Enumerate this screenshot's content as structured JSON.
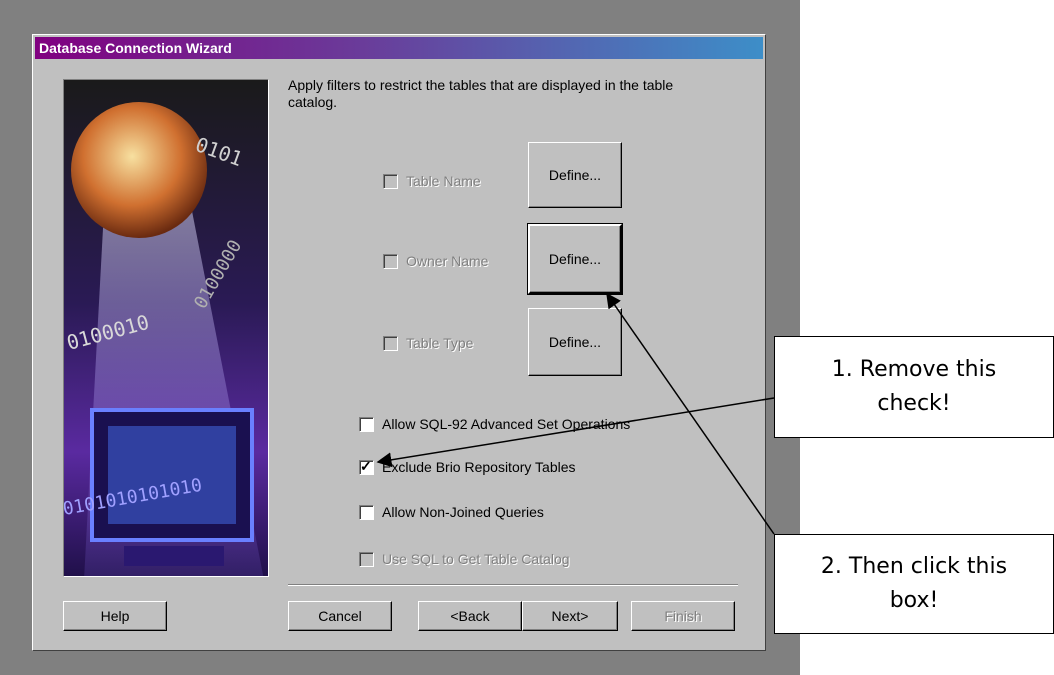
{
  "dialog": {
    "title": "Database Connection Wizard",
    "intro": "Apply filters to restrict the tables that are displayed in the table catalog."
  },
  "filters": [
    {
      "label": "Table Name",
      "button": "Define..."
    },
    {
      "label": "Owner Name",
      "button": "Define..."
    },
    {
      "label": "Table Type",
      "button": "Define..."
    }
  ],
  "options": [
    {
      "label": "Allow SQL-92 Advanced Set Operations",
      "checked": false,
      "enabled": true
    },
    {
      "label": "Exclude Brio Repository Tables",
      "checked": true,
      "enabled": true
    },
    {
      "label": "Allow Non-Joined Queries",
      "checked": false,
      "enabled": true
    },
    {
      "label": "Use SQL to Get Table Catalog",
      "checked": false,
      "enabled": false
    }
  ],
  "buttons": {
    "help": "Help",
    "cancel": "Cancel",
    "back": "<Back",
    "next": "Next>",
    "finish": "Finish"
  },
  "callouts": {
    "first": "1.  Remove this check!",
    "second": "2.  Then click this box!"
  },
  "art_text": {
    "binary_top": "0101",
    "binary_right": "0100000",
    "binary_left": "0100010",
    "binary_bottom": "0101010101010"
  }
}
